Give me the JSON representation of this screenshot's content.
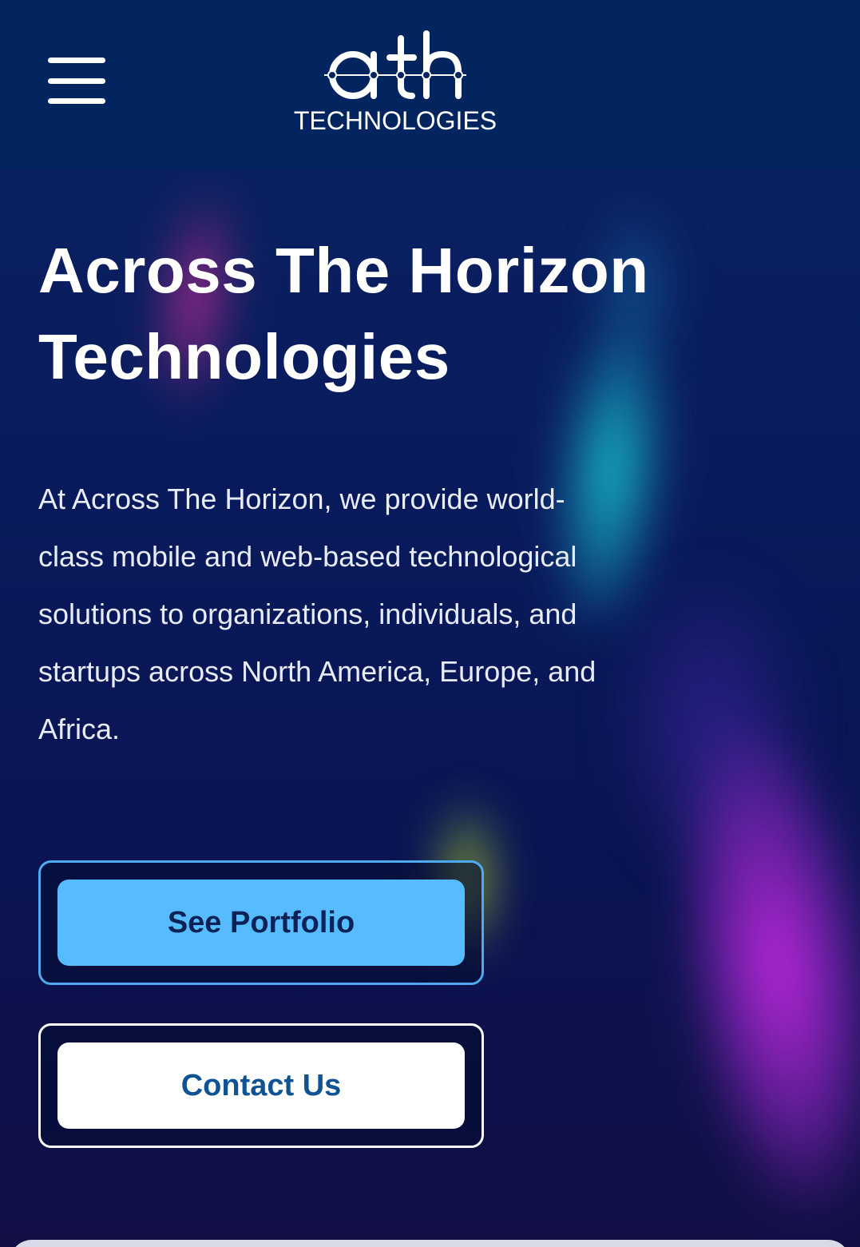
{
  "header": {
    "menu_icon": "hamburger-menu-icon",
    "logo_mark_text": "ath",
    "logo_sub_text": "TECHNOLOGIES",
    "background": "#022560"
  },
  "hero": {
    "title_line1": "Across The Horizon",
    "title_line2": "Technologies",
    "description": "At Across The Horizon, we provide world-class mobile and web-based technological solutions to organizations, individuals, and startups across North America, Europe, and Africa."
  },
  "buttons": {
    "portfolio_label": "See Portfolio",
    "contact_label": "Contact Us"
  },
  "colors": {
    "primary_button": "#57bbff",
    "primary_outline": "#4ea9ef",
    "contact_text": "#0f5394",
    "page_background": "#0a1a5c"
  }
}
